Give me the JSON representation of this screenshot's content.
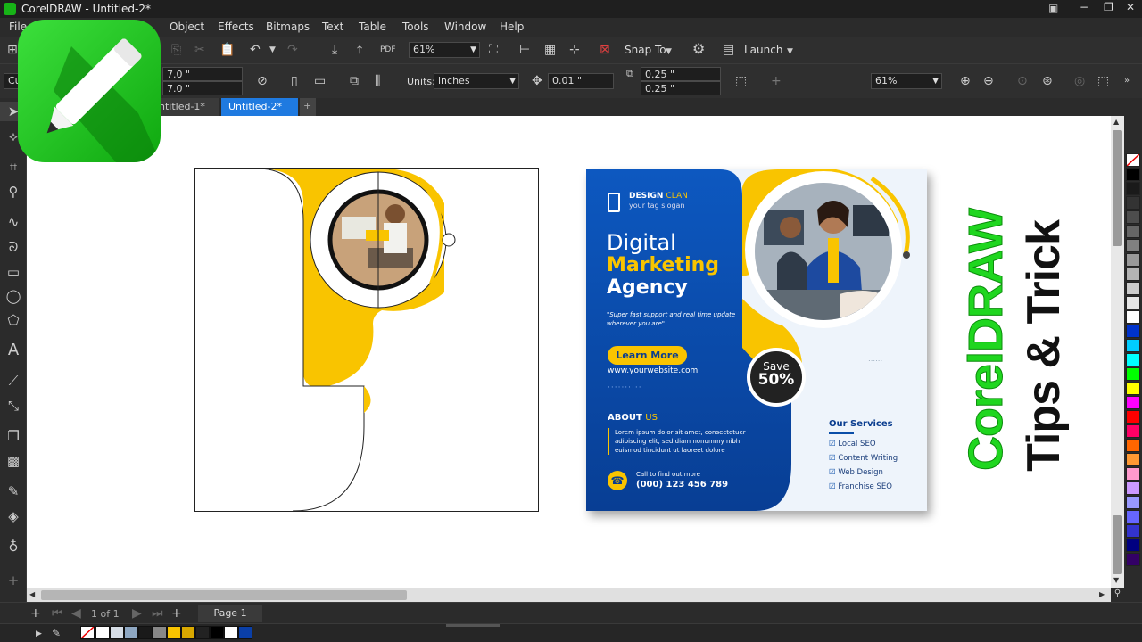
{
  "app": {
    "title": "CorelDRAW - Untitled-2*",
    "window_controls": [
      "−",
      "❐",
      "✕"
    ]
  },
  "menu": [
    "File",
    "Object",
    "Effects",
    "Bitmaps",
    "Text",
    "Table",
    "Tools",
    "Window",
    "Help"
  ],
  "toolbar1": {
    "zoom_value": "61%",
    "snap_label": "Snap To",
    "launch_label": "Launch"
  },
  "toolbar2": {
    "object_prefix": "Cu",
    "width_value": "7.0 \"",
    "height_value": "7.0 \"",
    "units_label": "Units:",
    "units_value": "inches",
    "nudge_value": "0.01 \"",
    "dup_x_value": "0.25 \"",
    "dup_y_value": "0.25 \"",
    "zoom_value": "61%"
  },
  "tabs": [
    {
      "label": "ntitled-1*",
      "active": false
    },
    {
      "label": "Untitled-2*",
      "active": true
    }
  ],
  "pagebar": {
    "page_counter": "1 of 1",
    "page_tab": "Page 1"
  },
  "flyer": {
    "brand_name": "DESIGN",
    "brand_name_accent": "CLAN",
    "brand_slogan": "your tag slogan",
    "headline_1": "Digital",
    "headline_2": "Marketing",
    "headline_3": "Agency",
    "quote": "\"Super fast support and real time update wherever you are\"",
    "cta_button": "Learn More",
    "website": "www.yourwebsite.com",
    "about_label": "ABOUT",
    "about_accent": "US",
    "about_text": "Lorem ipsum dolor sit amet, consectetuer adipiscing elit, sed diam nonummy nibh euismod tincidunt ut laoreet dolore",
    "call_label": "Call to find out more",
    "phone": "(000) 123 456 789",
    "save_label": "Save",
    "save_value": "50%",
    "services_title": "Our Services",
    "services": [
      "Local SEO",
      "Content Writing",
      "Web Design",
      "Franchise SEO"
    ]
  },
  "overlay_text": {
    "line1": "CorelDRAW",
    "line2": "Tips & Trick"
  },
  "colors": {
    "accent_yellow": "#f9c400",
    "flyer_blue": "#0a4ea8",
    "overlay_green": "#1fd61f",
    "active_tab": "#1f7ae0"
  },
  "palette": [
    "#ffffff",
    "#000000",
    "#1a1a1a",
    "#333333",
    "#4d4d4d",
    "#666666",
    "#808080",
    "#999999",
    "#b3b3b3",
    "#cccccc",
    "#e6e6e6",
    "#ffffff",
    "#0033cc",
    "#00ccff",
    "#00ffff",
    "#00ff00",
    "#ffff00",
    "#ff00ff",
    "#ff0000",
    "#ff0066",
    "#ff6600",
    "#ff9933",
    "#ff99cc",
    "#cc99ff",
    "#9999ff",
    "#6666ff",
    "#3333cc",
    "#000080",
    "#330066"
  ],
  "bottom_swatches": [
    "#ffffff",
    "#d6dde6",
    "#8ea7c2",
    "#1a1a1a",
    "#888888",
    "#f9c400",
    "#d9a800",
    "#222222",
    "#000000",
    "#ffffff",
    "#0a3fa8"
  ]
}
